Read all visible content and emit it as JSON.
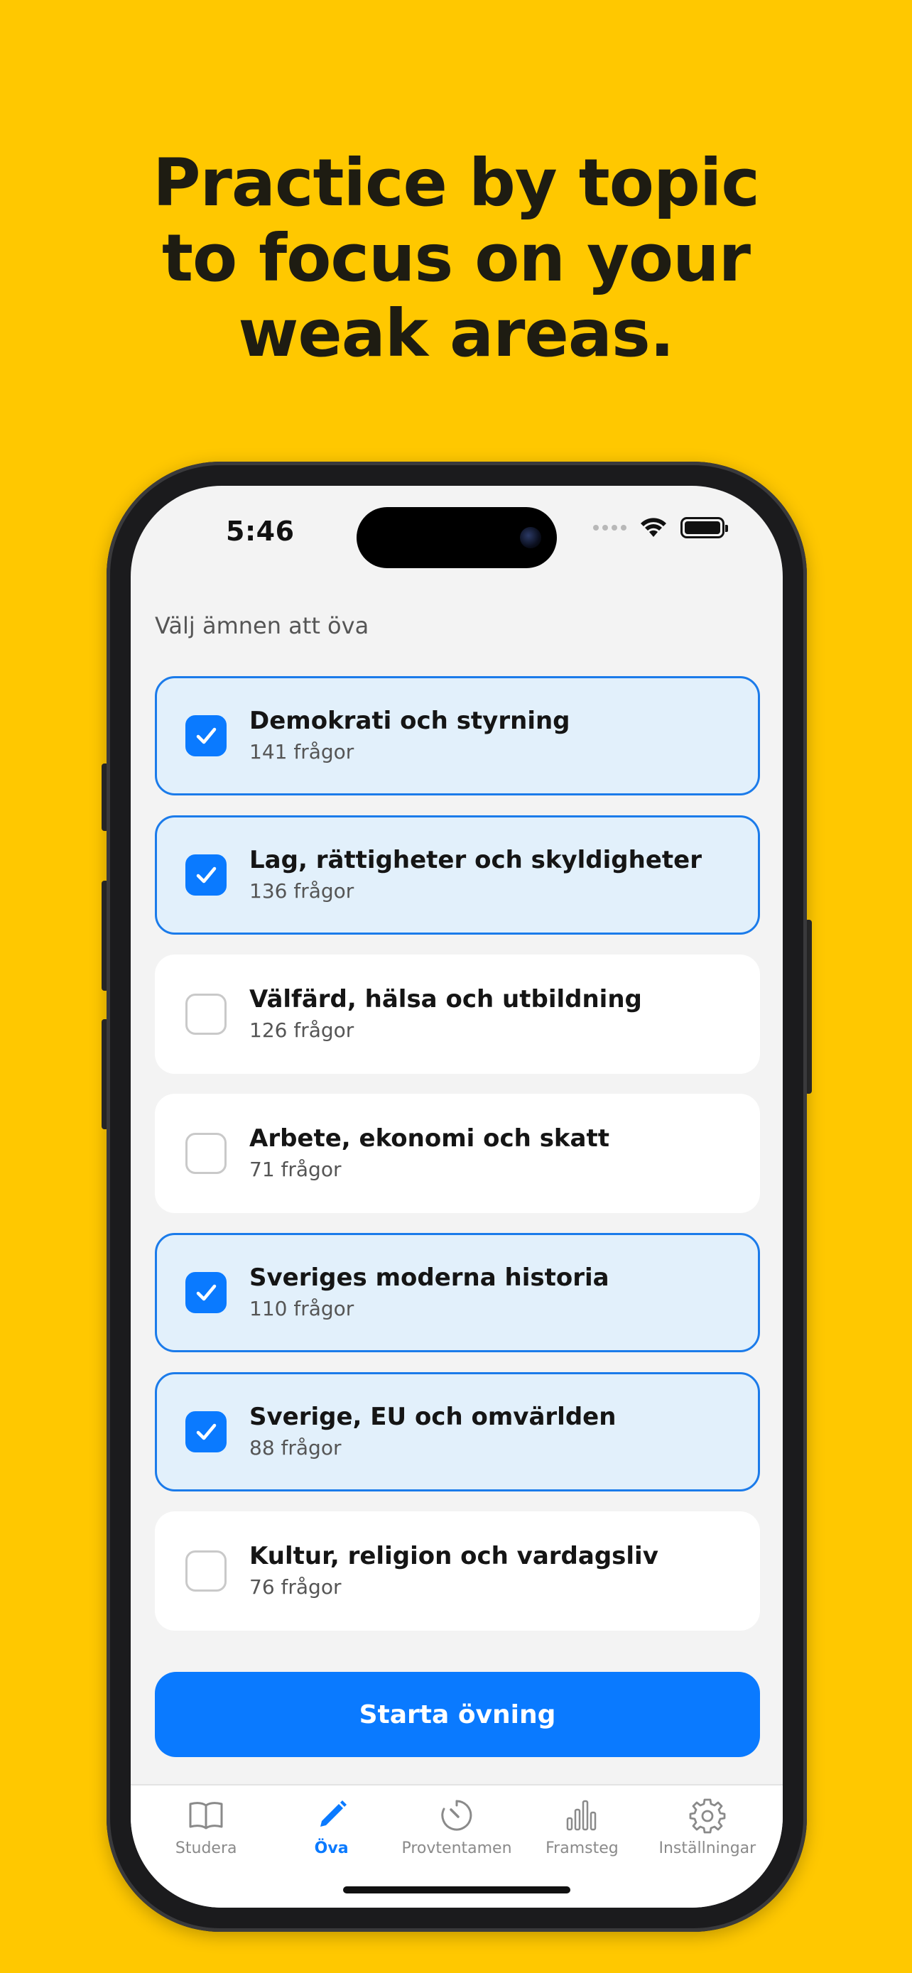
{
  "headline": {
    "line1": "Practice by topic",
    "line2": "to focus on your",
    "line3": "weak areas."
  },
  "status_bar": {
    "time": "5:46"
  },
  "section_title": "Välj ämnen att öva",
  "topics": [
    {
      "title": "Demokrati och styrning",
      "count": "141 frågor",
      "checked": true
    },
    {
      "title": "Lag, rättigheter och skyldigheter",
      "count": "136 frågor",
      "checked": true
    },
    {
      "title": "Välfärd, hälsa och utbildning",
      "count": "126 frågor",
      "checked": false
    },
    {
      "title": "Arbete, ekonomi och skatt",
      "count": "71 frågor",
      "checked": false
    },
    {
      "title": "Sveriges moderna historia",
      "count": "110 frågor",
      "checked": true
    },
    {
      "title": "Sverige, EU och omvärlden",
      "count": "88 frågor",
      "checked": true
    },
    {
      "title": "Kultur, religion och vardagsliv",
      "count": "76 frågor",
      "checked": false
    }
  ],
  "start_button": "Starta övning",
  "tabs": [
    {
      "label": "Studera",
      "icon": "book-icon",
      "active": false
    },
    {
      "label": "Öva",
      "icon": "pencil-icon",
      "active": true
    },
    {
      "label": "Provtentamen",
      "icon": "timer-icon",
      "active": false
    },
    {
      "label": "Framsteg",
      "icon": "bar-chart-icon",
      "active": false
    },
    {
      "label": "Inställningar",
      "icon": "gear-icon",
      "active": false
    }
  ],
  "colors": {
    "background": "#FFC800",
    "accent": "#0A7AFF",
    "selected_card": "#E2F0FB"
  }
}
